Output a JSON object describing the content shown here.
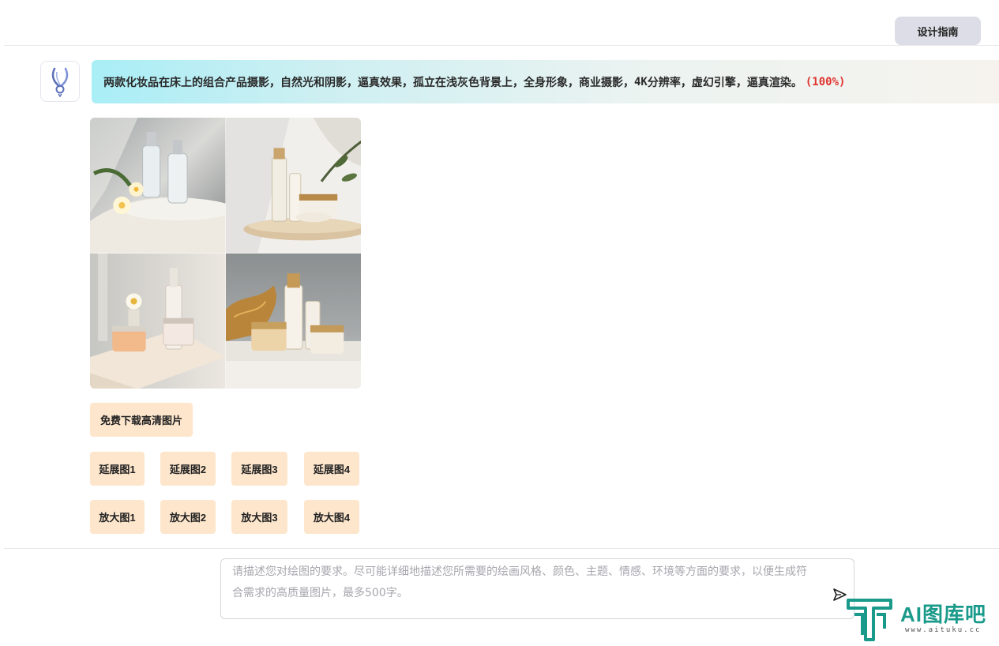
{
  "header": {
    "guide_label": "设计指南"
  },
  "message": {
    "prompt": "两款化妆品在床上的组合产品摄影，自然光和阴影，逼真效果，孤立在浅灰色背景上，全身形象，商业摄影，",
    "prompt_res": "4K",
    "prompt_tail": "分辨率，虚幻引擎，逼真渲染。",
    "progress": "(100%)"
  },
  "actions": {
    "download_label": "免费下载高清图片",
    "extend": [
      "延展图1",
      "延展图2",
      "延展图3",
      "延展图4"
    ],
    "upscale": [
      "放大图1",
      "放大图2",
      "放大图3",
      "放大图4"
    ]
  },
  "composer": {
    "placeholder": "请描述您对绘图的要求。尽可能详细地描述您所需要的绘画风格、颜色、主题、情感、环境等方面的要求，以便生成符合需求的高质量图片，最多500字。"
  },
  "watermark": {
    "brand": "AI图库吧",
    "url": "www.aituku.cc"
  },
  "colors": {
    "accent_button": "#fde6cc",
    "progress_red": "#e0332f",
    "brand_teal": "#1a9a8a"
  }
}
